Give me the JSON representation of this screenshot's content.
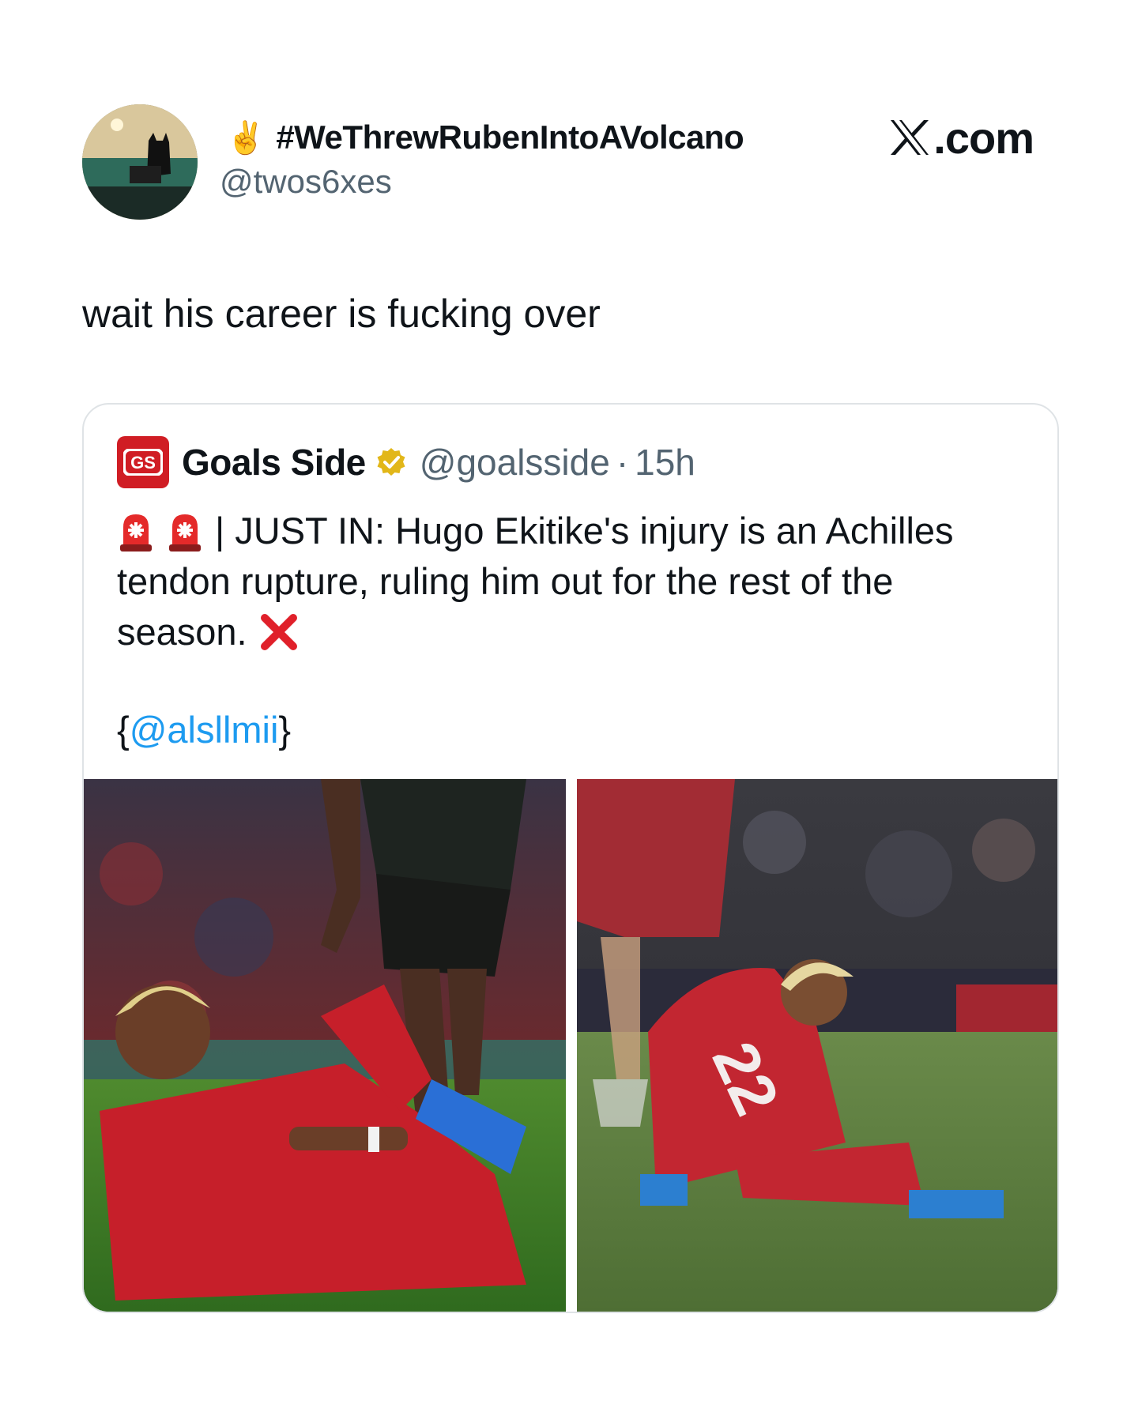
{
  "author": {
    "display_name": "#WeThrewRubenIntoAVolcano",
    "display_emoji": "✌️",
    "handle": "@twos6xes",
    "avatar_icon": "avatar-image"
  },
  "brand": {
    "label": ".com",
    "logo_icon": "x-logo-icon"
  },
  "tweet": {
    "text": "wait his career is fucking over"
  },
  "quoted_tweet": {
    "author_name": "Goals Side",
    "verified": "gold",
    "handle": "@goalsside",
    "separator": "·",
    "time": "15h",
    "line1": "| JUST IN: Hugo Ekitike's injury is an Achilles",
    "line2": "tendon rupture, ruling him out for the rest of the",
    "line3": "season.",
    "credit_open": "{",
    "credit_mention": "@alsllmii",
    "credit_close": "}",
    "icons": [
      "siren-icon",
      "siren-icon",
      "cross-mark-icon"
    ],
    "images": [
      "player-injured-on-pitch-photo",
      "player-down-on-grass-photo"
    ]
  },
  "colors": {
    "text": "#0f1419",
    "muted": "#536471",
    "link": "#1d9bf0",
    "border": "#dfe3e6",
    "verified_gold": "#e2b719",
    "brand_red": "#d01d24"
  }
}
